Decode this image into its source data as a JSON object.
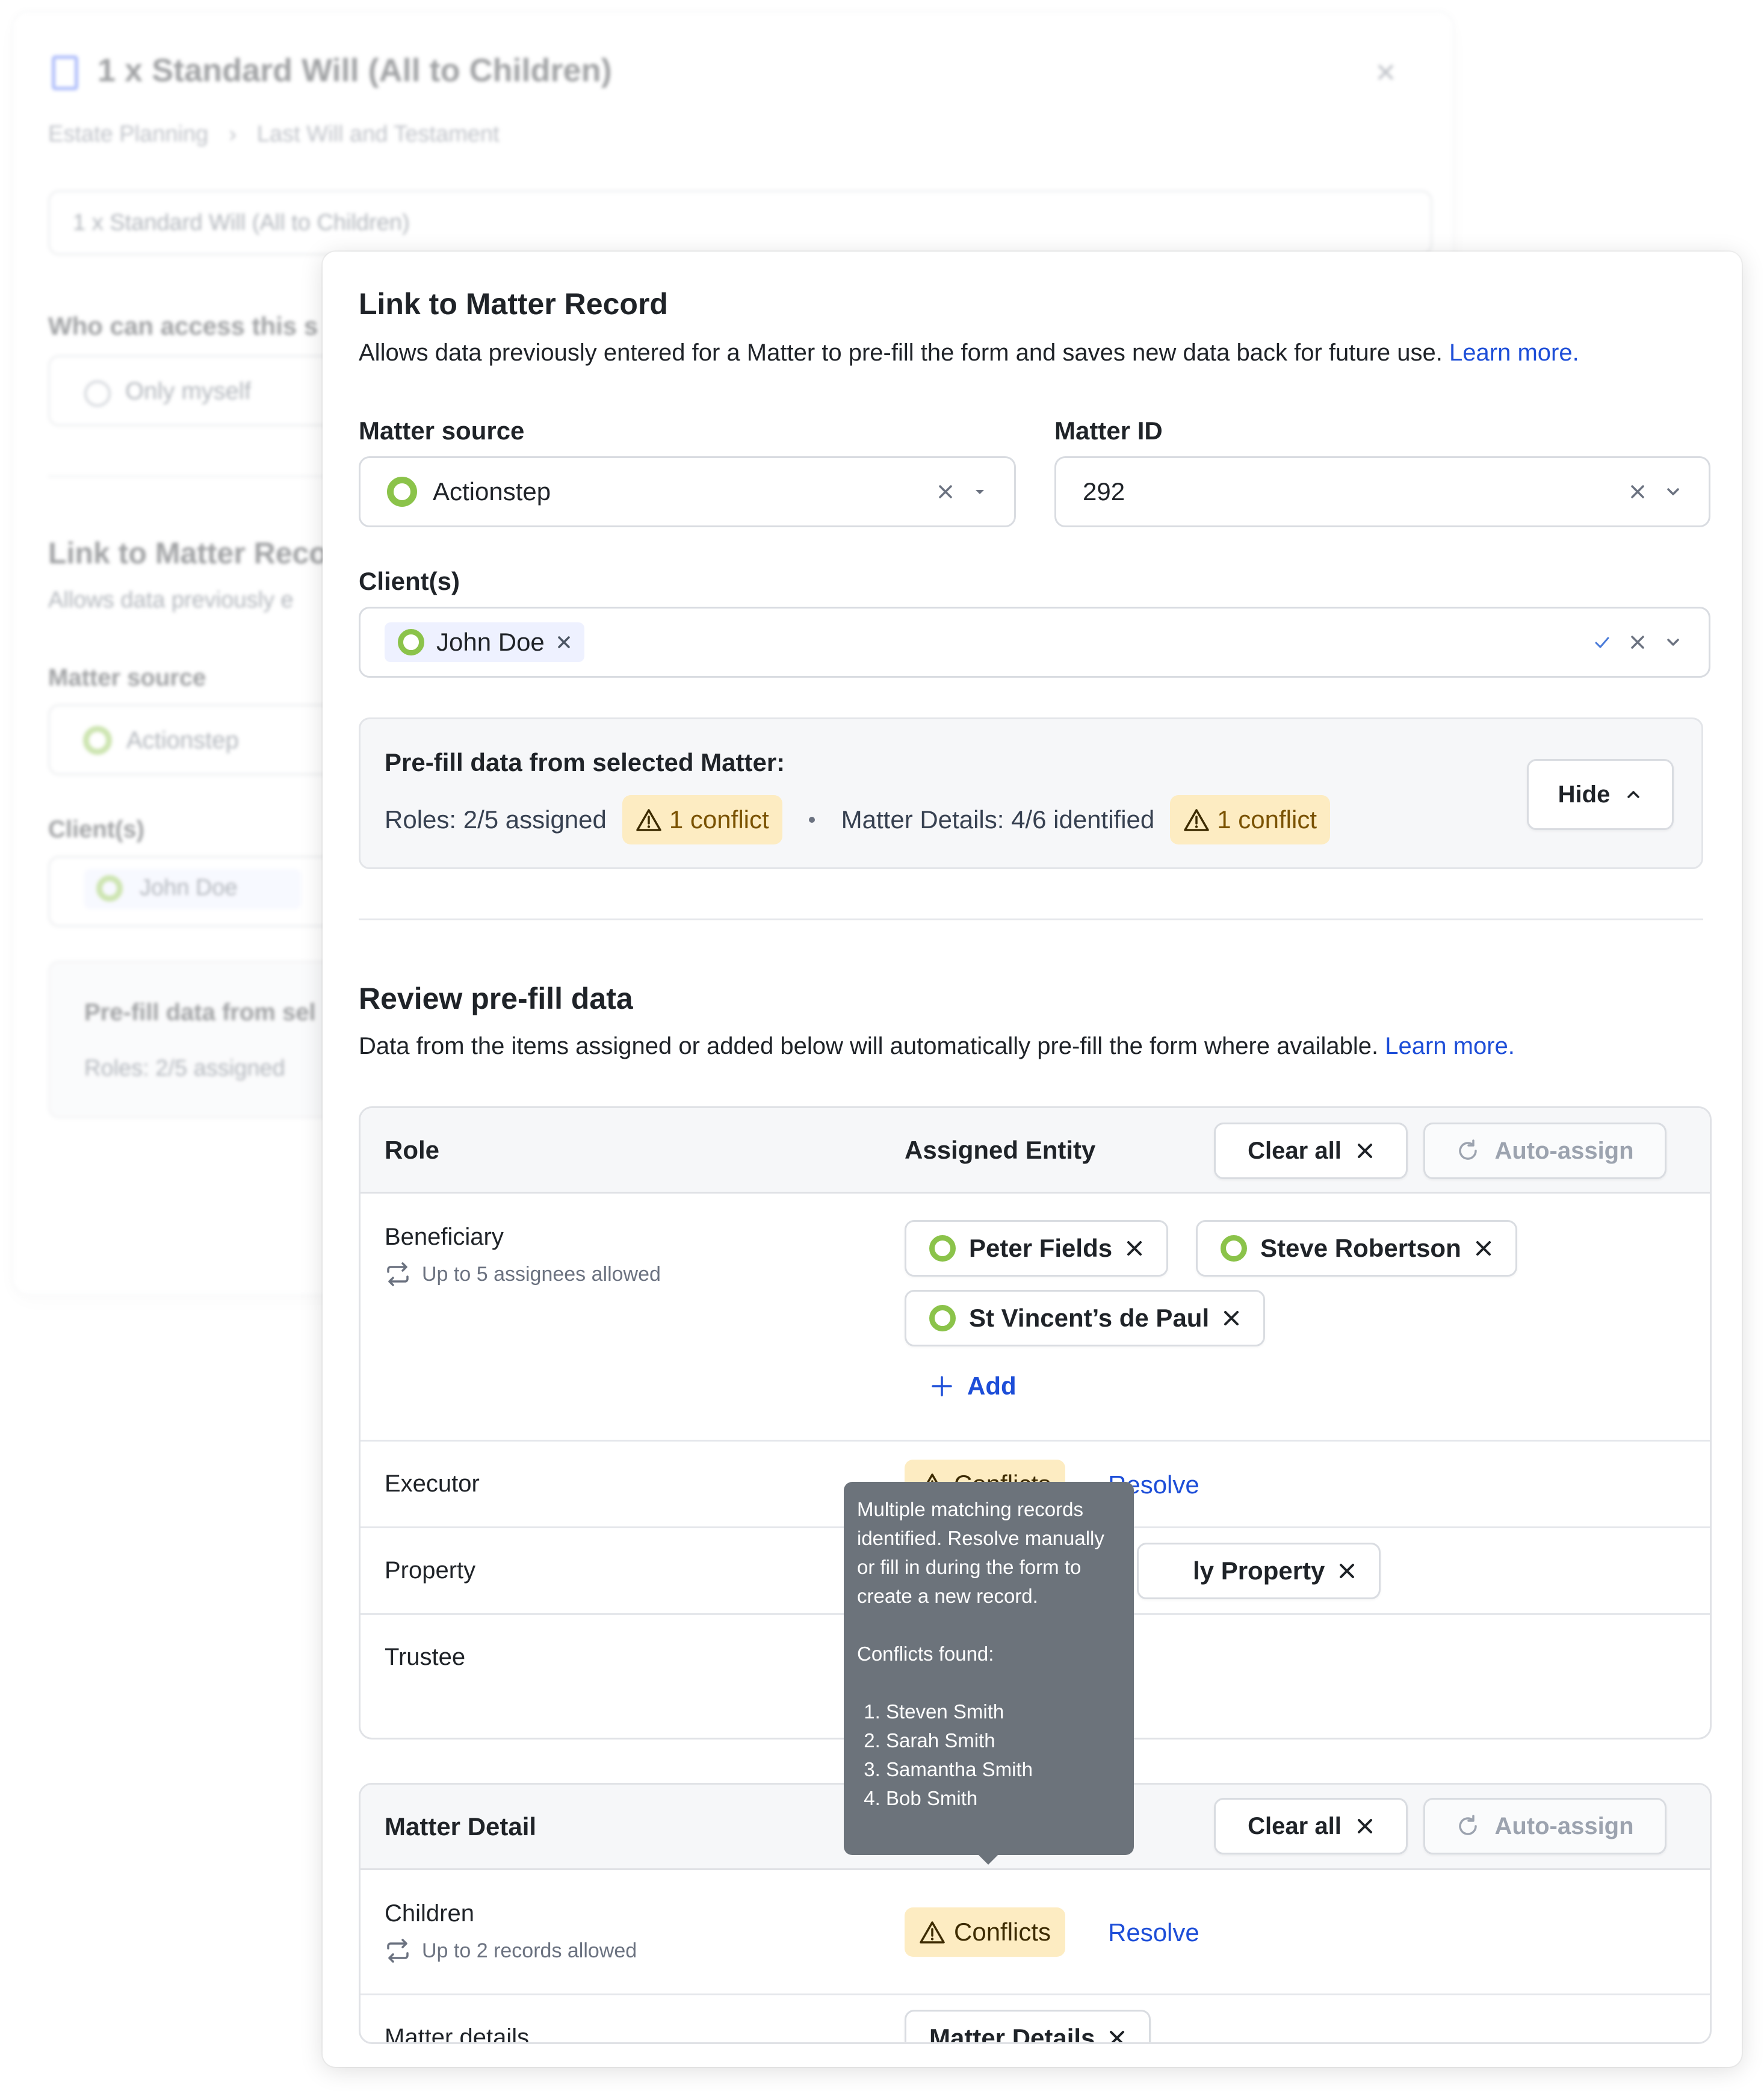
{
  "background": {
    "title": "1 x Standard Will (All to Children)",
    "breadcrumb": [
      "Estate Planning",
      "Last Will and Testament"
    ],
    "name_value": "1 x Standard Will (All to Children)",
    "access_heading": "Who can access this s",
    "access_option": "Only myself",
    "section_title": "Link to Matter Reco",
    "section_desc": "Allows data previously e",
    "matter_source_label": "Matter source",
    "matter_source_value": "Actionstep",
    "clients_label": "Client(s)",
    "client_chip": "John Doe",
    "prefill_title": "Pre-fill data from sel",
    "prefill_roles": "Roles: 2/5 assigned"
  },
  "panel": {
    "title": "Link to Matter Record",
    "description": "Allows data previously entered for a Matter to pre-fill the form and saves new data back for future use.",
    "learn_more": "Learn more.",
    "matter_source": {
      "label": "Matter source",
      "value": "Actionstep"
    },
    "matter_id": {
      "label": "Matter ID",
      "value": "292"
    },
    "clients": {
      "label": "Client(s)",
      "chip": "John Doe"
    },
    "prefill": {
      "title": "Pre-fill data from selected Matter:",
      "roles": "Roles: 2/5 assigned",
      "roles_conflict": "1 conflict",
      "details": "Matter Details: 4/6 identified",
      "details_conflict": "1 conflict",
      "hide_button": "Hide"
    },
    "review": {
      "title": "Review pre-fill data",
      "description": "Data from the items assigned or added below will automatically pre-fill the form where available.",
      "learn_more": "Learn more."
    },
    "roles_table": {
      "col_role": "Role",
      "col_entity": "Assigned Entity",
      "clear_all": "Clear all",
      "auto_assign": "Auto-assign",
      "rows": [
        {
          "role": "Beneficiary",
          "note": "Up to 5 assignees allowed",
          "entities": [
            "Peter Fields",
            "Steve Robertson",
            "St Vincent’s de Paul"
          ],
          "add": "Add"
        },
        {
          "role": "Executor",
          "conflicts": "Conflicts",
          "resolve": "Resolve"
        },
        {
          "role": "Property",
          "entity_partial": "ly Property"
        },
        {
          "role": "Trustee"
        }
      ]
    },
    "details_table": {
      "col_detail": "Matter Detail",
      "clear_all": "Clear all",
      "auto_assign": "Auto-assign",
      "rows": [
        {
          "detail": "Children",
          "note": "Up to 2 records allowed",
          "conflicts": "Conflicts",
          "resolve": "Resolve"
        },
        {
          "detail": "Matter details",
          "entity": "Matter Details"
        }
      ]
    },
    "tooltip": {
      "message": "Multiple matching records identified. Resolve manually or fill in during the form to create a new record.",
      "conflicts_heading": "Conflicts found:",
      "conflicts": [
        "Steven Smith",
        "Sarah Smith",
        "Samantha Smith",
        "Bob Smith"
      ]
    }
  },
  "colors": {
    "accent_link": "#1d4ed8",
    "actionstep_green": "#8bc34a",
    "warning_bg": "#fdecc2",
    "tooltip_bg": "#6c737b"
  },
  "icons": [
    "document-icon",
    "close-icon",
    "chevron-down-icon",
    "caret-down-icon",
    "check-icon",
    "warning-icon",
    "chevron-up-icon",
    "repeat-icon",
    "plus-icon",
    "refresh-icon",
    "actionstep-logo-icon"
  ]
}
